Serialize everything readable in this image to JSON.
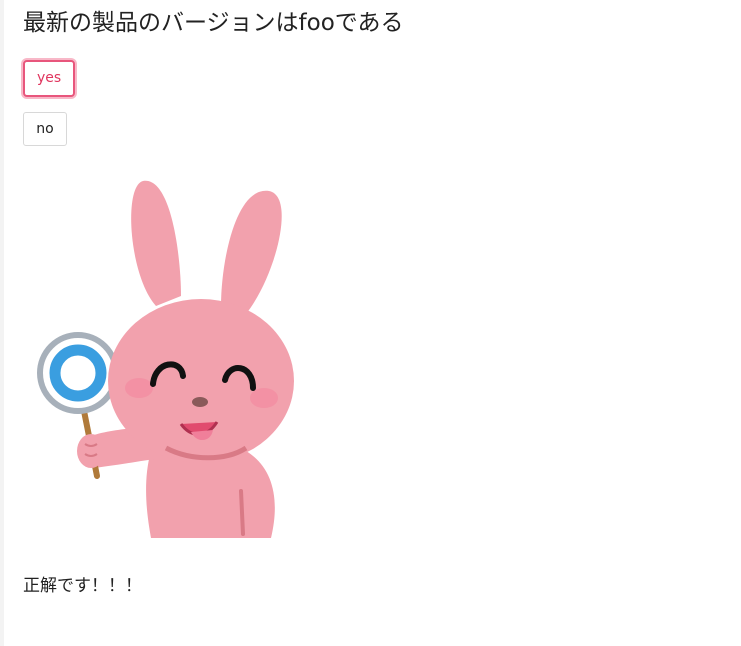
{
  "question": "最新の製品のバージョンはfooである",
  "buttons": {
    "yes_label": "yes",
    "no_label": "no"
  },
  "result": "正解です！！！",
  "colors": {
    "selected_border": "#e8567c",
    "rabbit_pink": "#f2a1ad",
    "sign_ring": "#3a9ee0"
  }
}
